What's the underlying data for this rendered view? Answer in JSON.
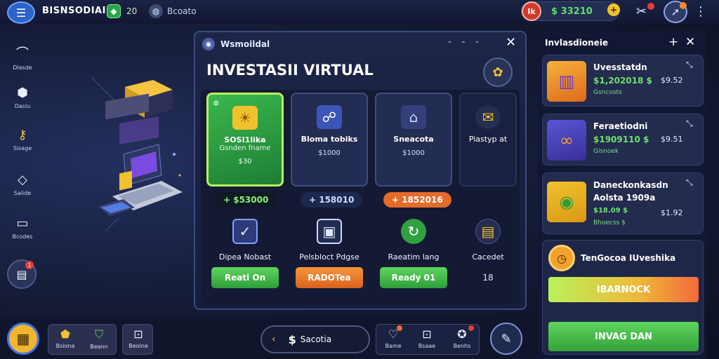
{
  "topbar": {
    "app_title": "BISNSODIAI",
    "gem_count": "20",
    "status_label": "Bcoato",
    "balance_badge": "Ik",
    "balance_value": "$ 33210",
    "balance_plus": "+"
  },
  "sidebar": {
    "items": [
      {
        "label": "Dlasde",
        "icon": "arch-icon"
      },
      {
        "label": "Dasiu",
        "icon": "box-icon"
      },
      {
        "label": "Sisage",
        "icon": "key-icon"
      },
      {
        "label": "Saiide",
        "icon": "diamond-icon"
      },
      {
        "label": "Bcodes",
        "icon": "monitor-icon"
      }
    ],
    "badge_count": "1"
  },
  "dialog": {
    "app_name": "Wsmoildal",
    "title": "INVESTASII VIRTUAL",
    "cards": [
      {
        "title": "SOSI1lika",
        "subtitle": "Gsnden fname",
        "price": "$30",
        "value": "+ $53000"
      },
      {
        "title": "Bloma tobiks",
        "subtitle": "",
        "price": "$1000",
        "value": "+ 158010"
      },
      {
        "title": "Sneacota",
        "subtitle": "",
        "price": "$1000",
        "value": "+ 1852016"
      },
      {
        "title": "Piastyp at",
        "subtitle": "",
        "price": "",
        "value": ""
      }
    ],
    "features": [
      {
        "label": "Dipea Nobast",
        "button": "Reati On"
      },
      {
        "label": "Pelsbloct Pdgse",
        "button": "RADOTea"
      },
      {
        "label": "Raeatim lang",
        "button": "Ready 01"
      },
      {
        "label": "Cacedet",
        "button": "18"
      }
    ]
  },
  "right_panel": {
    "title": "Invlasdioneie",
    "items": [
      {
        "title": "Uvesstatdn",
        "amount": "$1,202018 $",
        "price": "$9.52",
        "sub": "Gsncosts"
      },
      {
        "title": "Feraetiodni",
        "amount": "$1909110 $",
        "price": "$9.51",
        "sub": "Gisnoek"
      },
      {
        "title": "Daneckonkasdn",
        "title2": "Aolsta 1909a",
        "amount": "$18.09 $",
        "price": "$1.92",
        "sub": "Bhoecss $"
      }
    ],
    "promo": {
      "title": "TenGocoa IUveshika",
      "primary_button": "IBARNOCK",
      "secondary_button": "INVAG DAN"
    }
  },
  "bottombar": {
    "group1": [
      {
        "label": "Bsiona"
      },
      {
        "label": "Beann"
      }
    ],
    "group2": [
      {
        "label": "Beolne"
      }
    ],
    "search_label": "Sacotia",
    "group3": [
      {
        "label": "Bame"
      },
      {
        "label": "Bsaae"
      },
      {
        "label": "Benhs"
      }
    ]
  },
  "colors": {
    "accent_green": "#3ab84d",
    "accent_orange": "#f2812e",
    "accent_gold": "#f2c12e",
    "panel_bg": "#1d2548"
  }
}
